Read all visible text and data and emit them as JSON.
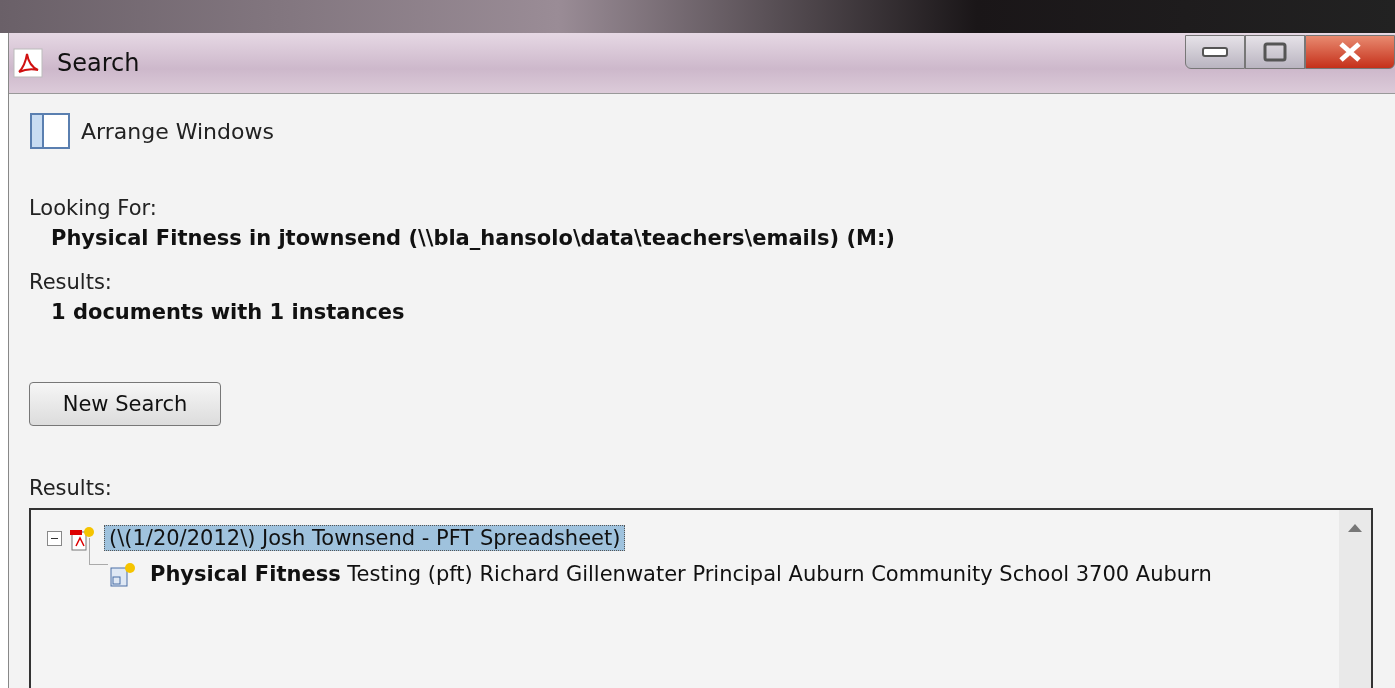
{
  "window": {
    "title": "Search"
  },
  "toolbar": {
    "arrange_windows": "Arrange Windows"
  },
  "looking_for": {
    "label": "Looking For:",
    "query": "Physical Fitness in jtownsend (\\\\bla_hansolo\\data\\teachers\\emails) (M:)"
  },
  "summary": {
    "label": "Results:",
    "count": "1 documents with 1 instances"
  },
  "new_search_button": "New Search",
  "results": {
    "label": "Results:",
    "tree": [
      {
        "label": "(\\(1/20/2012\\) Josh Townsend - PFT Spreadsheet)",
        "expanded": true,
        "selected": true,
        "children": [
          {
            "label": "**Physical Fitness** Testing (pft) Richard Gillenwater Principal Auburn Community School 3700 Auburn",
            "selected": false
          }
        ]
      }
    ]
  }
}
